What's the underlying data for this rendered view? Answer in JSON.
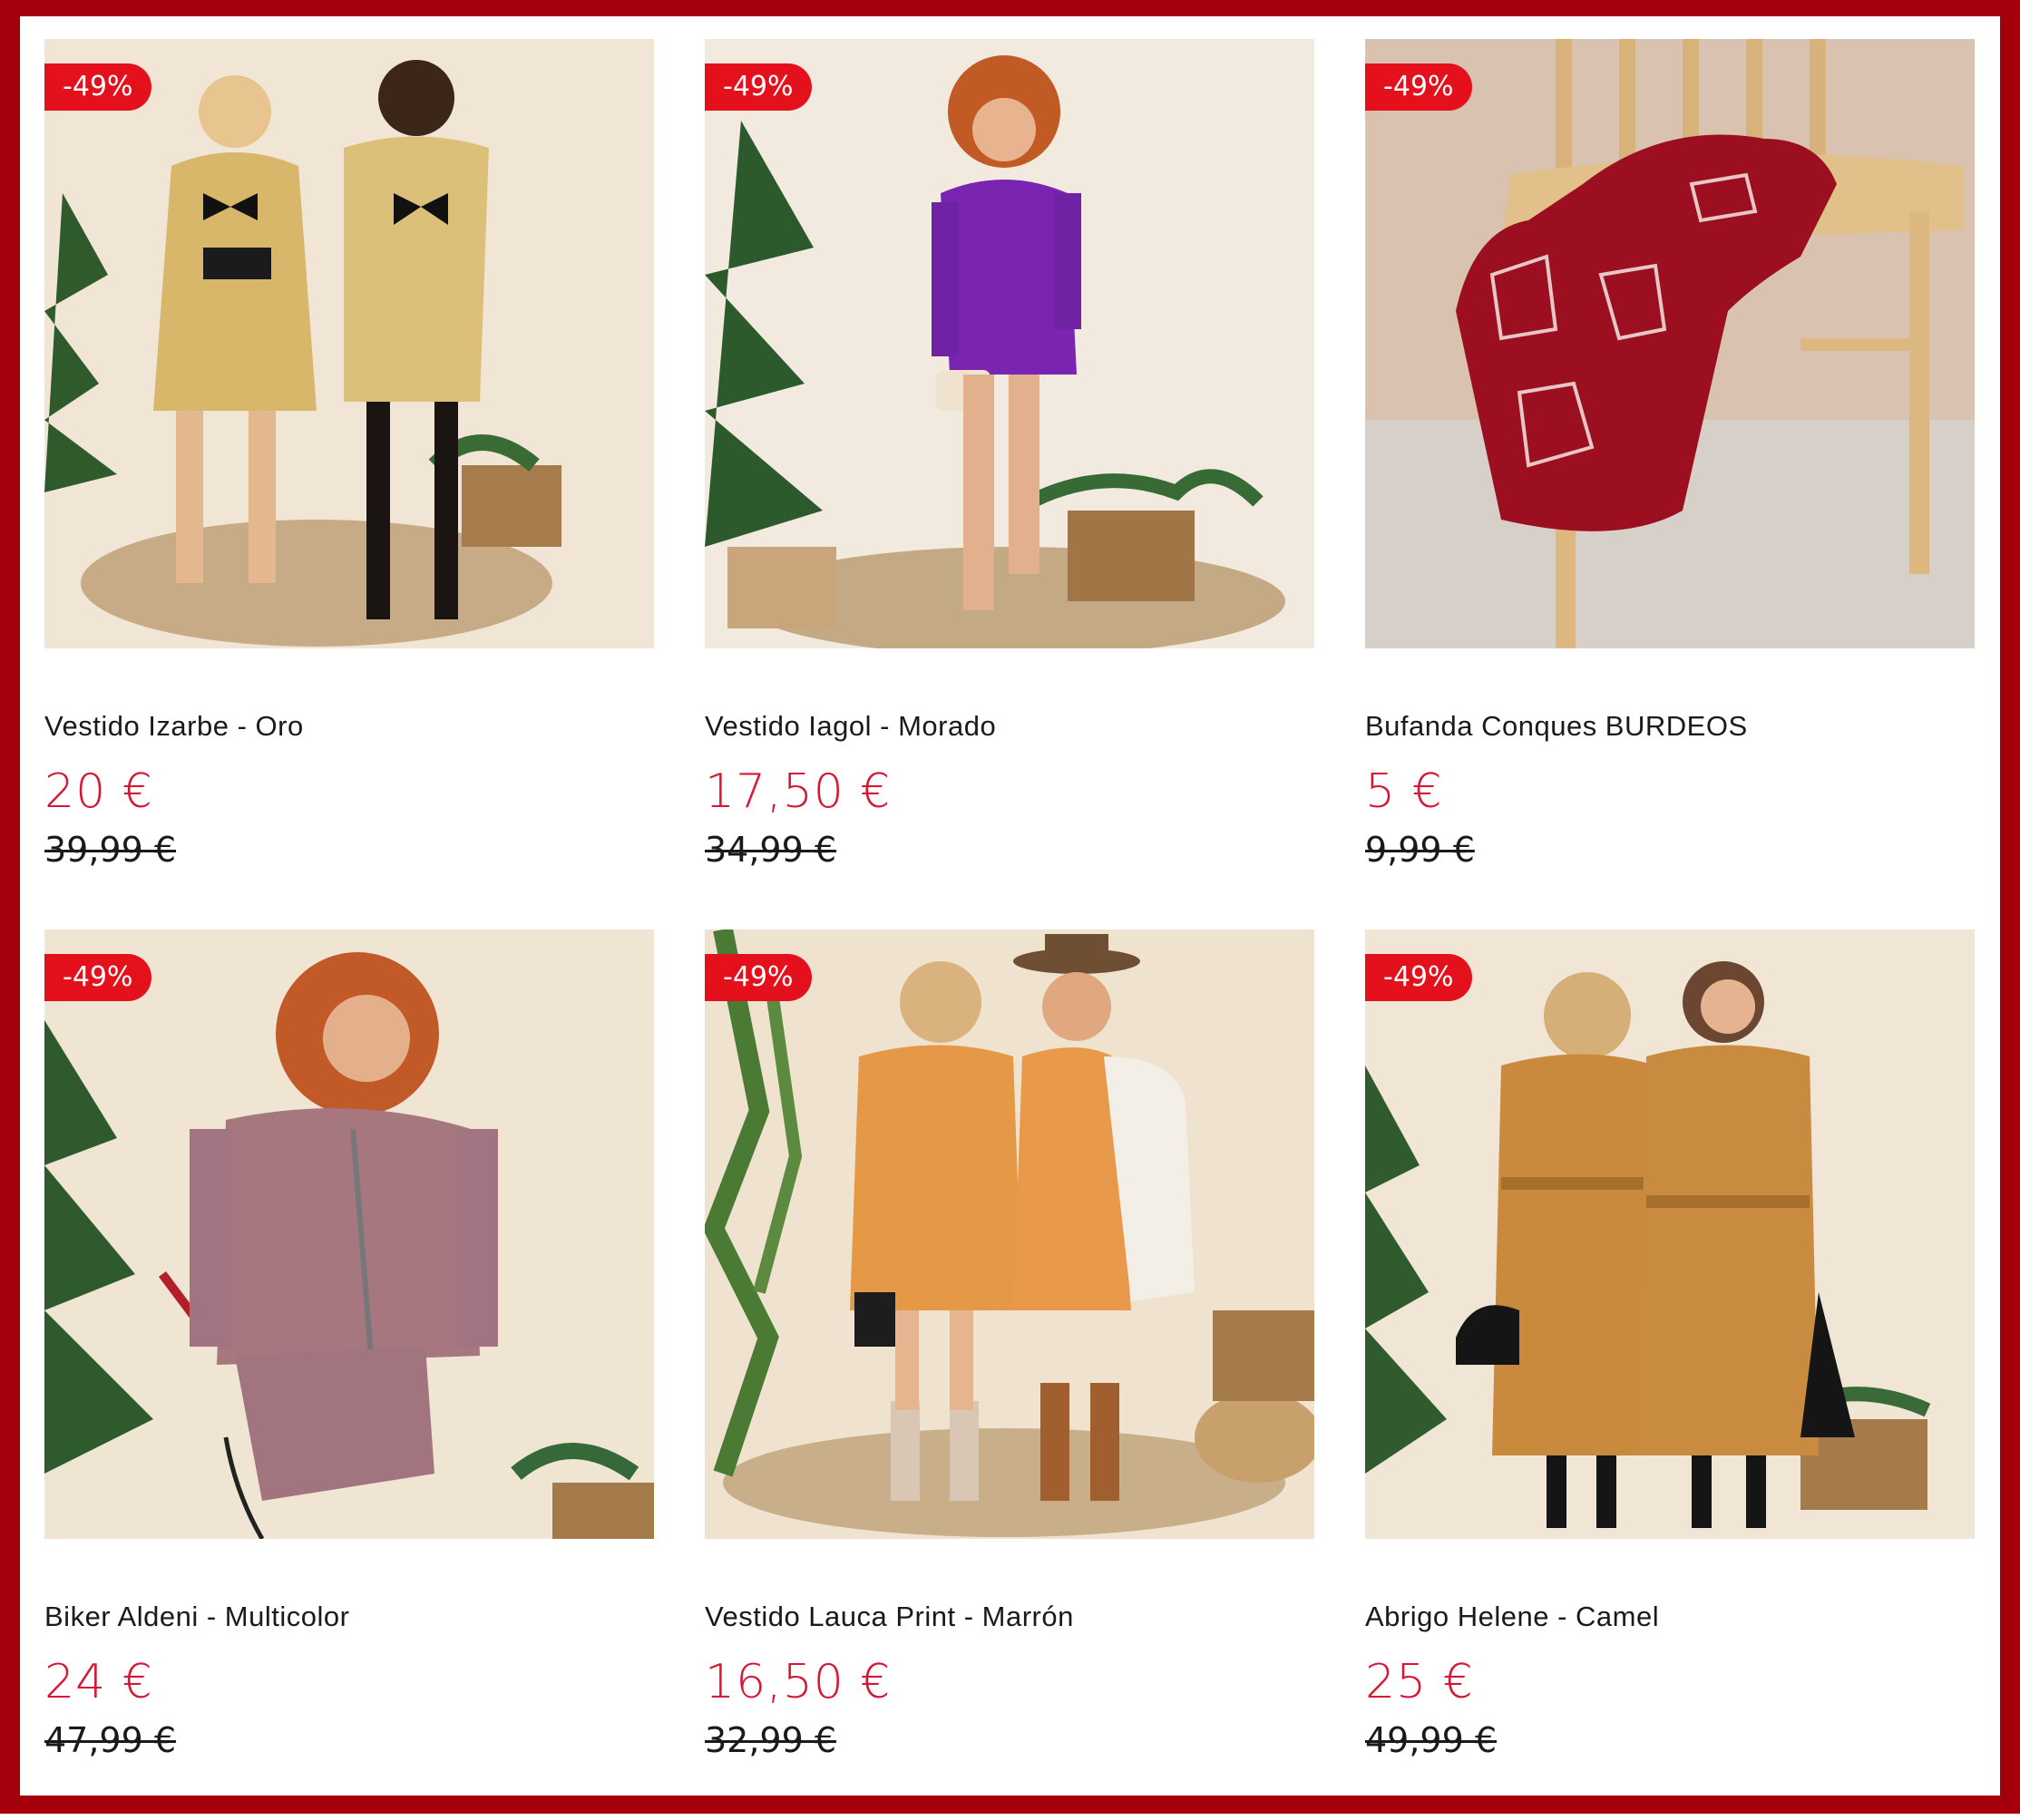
{
  "products": [
    {
      "badge": "-49%",
      "name": "Vestido Izarbe - Oro",
      "price": "20 €",
      "old_price": "39,99 €"
    },
    {
      "badge": "-49%",
      "name": "Vestido Iagol - Morado",
      "price": "17,50 €",
      "old_price": "34,99 €"
    },
    {
      "badge": "-49%",
      "name": "Bufanda Conques BURDEOS",
      "price": "5 €",
      "old_price": "9,99 €"
    },
    {
      "badge": "-49%",
      "name": "Biker Aldeni - Multicolor",
      "price": "24 €",
      "old_price": "47,99 €"
    },
    {
      "badge": "-49%",
      "name": "Vestido Lauca Print - Marrón",
      "price": "16,50 €",
      "old_price": "32,99 €"
    },
    {
      "badge": "-49%",
      "name": "Abrigo Helene - Camel",
      "price": "25 €",
      "old_price": "49,99 €"
    }
  ],
  "colors": {
    "frame": "#a4000c",
    "badge": "#e4111c",
    "price": "#d81633",
    "text": "#1a1a1a"
  }
}
